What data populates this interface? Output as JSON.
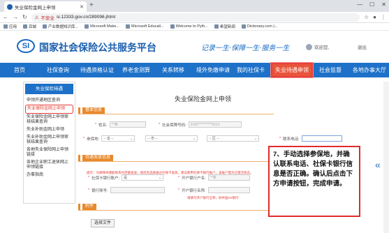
{
  "browser": {
    "tab_title": "失业保险金网上申领",
    "new_tab": "+",
    "address": "si.12333.gov.cn/289096.jhtml",
    "security_label": "不安全",
    "bookmarks": [
      "应用",
      "百城",
      "产业数据知识库...",
      "Microsoft Make...",
      "Microsoft Educati...",
      "Welcome to Pyth...",
      "希望新闻",
      "Dictionary.com |..."
    ]
  },
  "site": {
    "title": "国家社会保险公共服务平台",
    "logo_text": "SI",
    "slogan": "记录一生·保障一生·服务一生",
    "welcome": "欢迎您,",
    "logout": "退出"
  },
  "nav": [
    {
      "label": "首页"
    },
    {
      "label": "社保查询"
    },
    {
      "label": "待遇资格认证"
    },
    {
      "label": "养老金测算"
    },
    {
      "label": "关系转移"
    },
    {
      "label": "境外免缴申请"
    },
    {
      "label": "我的社保卡"
    },
    {
      "label": "失业待遇申领"
    },
    {
      "label": "社会监督"
    },
    {
      "label": "各地办事大厅"
    }
  ],
  "sidebar": {
    "title": "失业保险待遇",
    "items": [
      "申领开通地区查询",
      "失业保险金网上申领",
      "失业保险金网上申领审核结果查询",
      "失业补助金网上申领",
      "失业补助金网上申领审核结果查询",
      "各地失业保险网上申领链接",
      "各地企业职工退休网上申领链接",
      "办事指南"
    ]
  },
  "form": {
    "page_title": "失业保险金网上申领",
    "sections": [
      "基本信息",
      "待遇发放信息",
      "附件"
    ],
    "labels": {
      "name": "姓名:",
      "id_no": "社会保障号码:",
      "insured_place": "参保地:",
      "phone": "联系电话:",
      "bank_account_type": "社保卡银行账户:",
      "account_name": "开户银行户名:",
      "bank_account_no": "银行账号:",
      "bank_name": "开户银行名称:"
    },
    "values": {
      "name": "**荣",
      "id_no": "3326**********0013",
      "province": "-- 省 --",
      "city": "-- 市 --",
      "district": "-- 区 --",
      "bank_account_type": "是",
      "account_name": "**荣"
    },
    "notice": "提示：为保障待遇能够及时足额发放，请优先选择通过社保卡发放，建议使用社保卡银行账户，该账户需为已激活状态。",
    "hint": "请填写开户银行全称，如中国XX银行",
    "choose_file": "选择文件"
  },
  "callout": "7、手动选择参保地，并确认联系电话、社保卡银行信息是否正确。确认后点击下方申请按钮，完成申请。",
  "colors": {
    "brand_blue": "#1e71c8",
    "section_orange": "#e8892b",
    "highlight_red": "#e02b2b"
  }
}
